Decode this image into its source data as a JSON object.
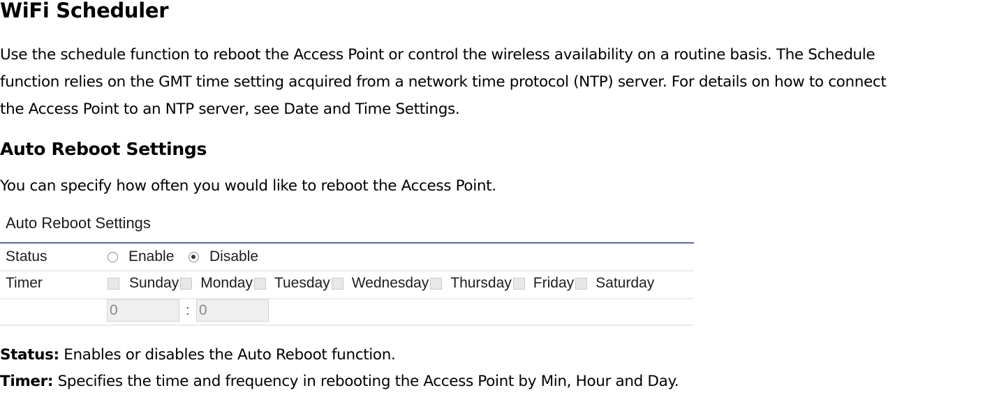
{
  "title": "WiFi Scheduler",
  "intro_lines": [
    "Use the schedule function to reboot the Access Point or control the wireless availability on a routine basis. The Schedule",
    "function relies on the GMT time setting acquired from a network time protocol (NTP) server. For details on how to connect",
    "the Access Point to an NTP server, see Date and Time Settings."
  ],
  "section_heading": "Auto Reboot Settings",
  "section_intro": "You can specify how often you would like to reboot the Access Point.",
  "panel": {
    "title": "Auto Reboot Settings",
    "status_label": "Status",
    "status_options": [
      {
        "label": "Enable",
        "checked": false
      },
      {
        "label": "Disable",
        "checked": true
      }
    ],
    "timer_label": "Timer",
    "days": [
      {
        "label": "Sunday",
        "checked": false
      },
      {
        "label": "Monday",
        "checked": false
      },
      {
        "label": "Tuesday",
        "checked": false
      },
      {
        "label": "Wednesday",
        "checked": false
      },
      {
        "label": "Thursday",
        "checked": false
      },
      {
        "label": "Friday",
        "checked": false
      },
      {
        "label": "Saturday",
        "checked": false
      }
    ],
    "hour_value": "0",
    "separator": ":",
    "minute_value": "0",
    "accent_color": "#4a6fb3"
  },
  "descriptions": [
    {
      "term": "Status:",
      "text": " Enables or disables the Auto Reboot function."
    },
    {
      "term": "Timer:",
      "text": " Specifies the time and frequency in rebooting the Access Point by Min, Hour and Day."
    }
  ]
}
